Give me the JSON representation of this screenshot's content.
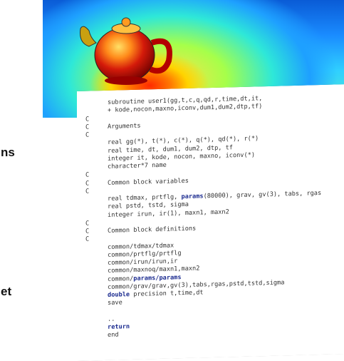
{
  "sidebar": {
    "fragment_1": "ns",
    "fragment_2": "et"
  },
  "code_lines": [
    {
      "id": "l0",
      "indent": "      ",
      "text": "subroutine user1(gg,t,c,q,qd,r,time,dt,it,"
    },
    {
      "id": "l1",
      "indent": "      ",
      "text": "+ kode,nocon,maxno,iconv,dum1,dum2,dtp,tf)"
    },
    {
      "id": "l2",
      "indent": "",
      "text": "C"
    },
    {
      "id": "l3",
      "indent": "",
      "text": "C     Arguments"
    },
    {
      "id": "l4",
      "indent": "",
      "text": "C"
    },
    {
      "id": "l5",
      "indent": "      ",
      "text": "real gg(*), t(*), c(*), q(*), qd(*), r(*)"
    },
    {
      "id": "l6",
      "indent": "      ",
      "text": "real time, dt, dum1, dum2, dtp, tf"
    },
    {
      "id": "l7",
      "indent": "      ",
      "text": "integer it, kode, nocon, maxno, iconv(*)"
    },
    {
      "id": "l8",
      "indent": "      ",
      "text": "character*7 name"
    },
    {
      "id": "l9",
      "indent": "",
      "text": "C"
    },
    {
      "id": "l10",
      "indent": "",
      "text": "C     Common block variables"
    },
    {
      "id": "l11",
      "indent": "",
      "text": "C"
    },
    {
      "id": "l12",
      "indent": "      ",
      "pre": "real tdmax, prtflg, ",
      "kw": "params",
      "post": "(80000), grav, gv(3), tabs, rgas"
    },
    {
      "id": "l13",
      "indent": "      ",
      "text": "real pstd, tstd, sigma"
    },
    {
      "id": "l14",
      "indent": "      ",
      "text": "integer irun, ir(1), maxn1, maxn2"
    },
    {
      "id": "l15",
      "indent": "",
      "text": "C"
    },
    {
      "id": "l16",
      "indent": "",
      "text": "C     Common block definitions"
    },
    {
      "id": "l17",
      "indent": "",
      "text": "C"
    },
    {
      "id": "l18",
      "indent": "      ",
      "text": "common/tdmax/tdmax"
    },
    {
      "id": "l19",
      "indent": "      ",
      "text": "common/prtflg/prtflg"
    },
    {
      "id": "l20",
      "indent": "      ",
      "text": "common/irun/irun,ir"
    },
    {
      "id": "l21",
      "indent": "      ",
      "text": "common/maxnoq/maxn1,maxn2"
    },
    {
      "id": "l22",
      "indent": "      ",
      "pre": "common/",
      "kw": "params/params",
      "post": ""
    },
    {
      "id": "l23",
      "indent": "      ",
      "text": "common/grav/grav,gv(3),tabs,rgas,pstd,tstd,sigma"
    },
    {
      "id": "l24",
      "indent": "      ",
      "pre": "",
      "kw": "double",
      "post": " precision t,time,dt"
    },
    {
      "id": "l25",
      "indent": "      ",
      "text": "save"
    },
    {
      "id": "l26",
      "indent": "",
      "text": ""
    },
    {
      "id": "l27",
      "indent": "      ",
      "text": ".."
    },
    {
      "id": "l28",
      "indent": "      ",
      "pre": "",
      "kw": "return",
      "post": ""
    },
    {
      "id": "l29",
      "indent": "      ",
      "text": "end"
    }
  ],
  "colors": {
    "keyword": "#1a2a8f",
    "code_text": "#333333"
  },
  "image": {
    "subject": "teapot-thermal-simulation"
  }
}
